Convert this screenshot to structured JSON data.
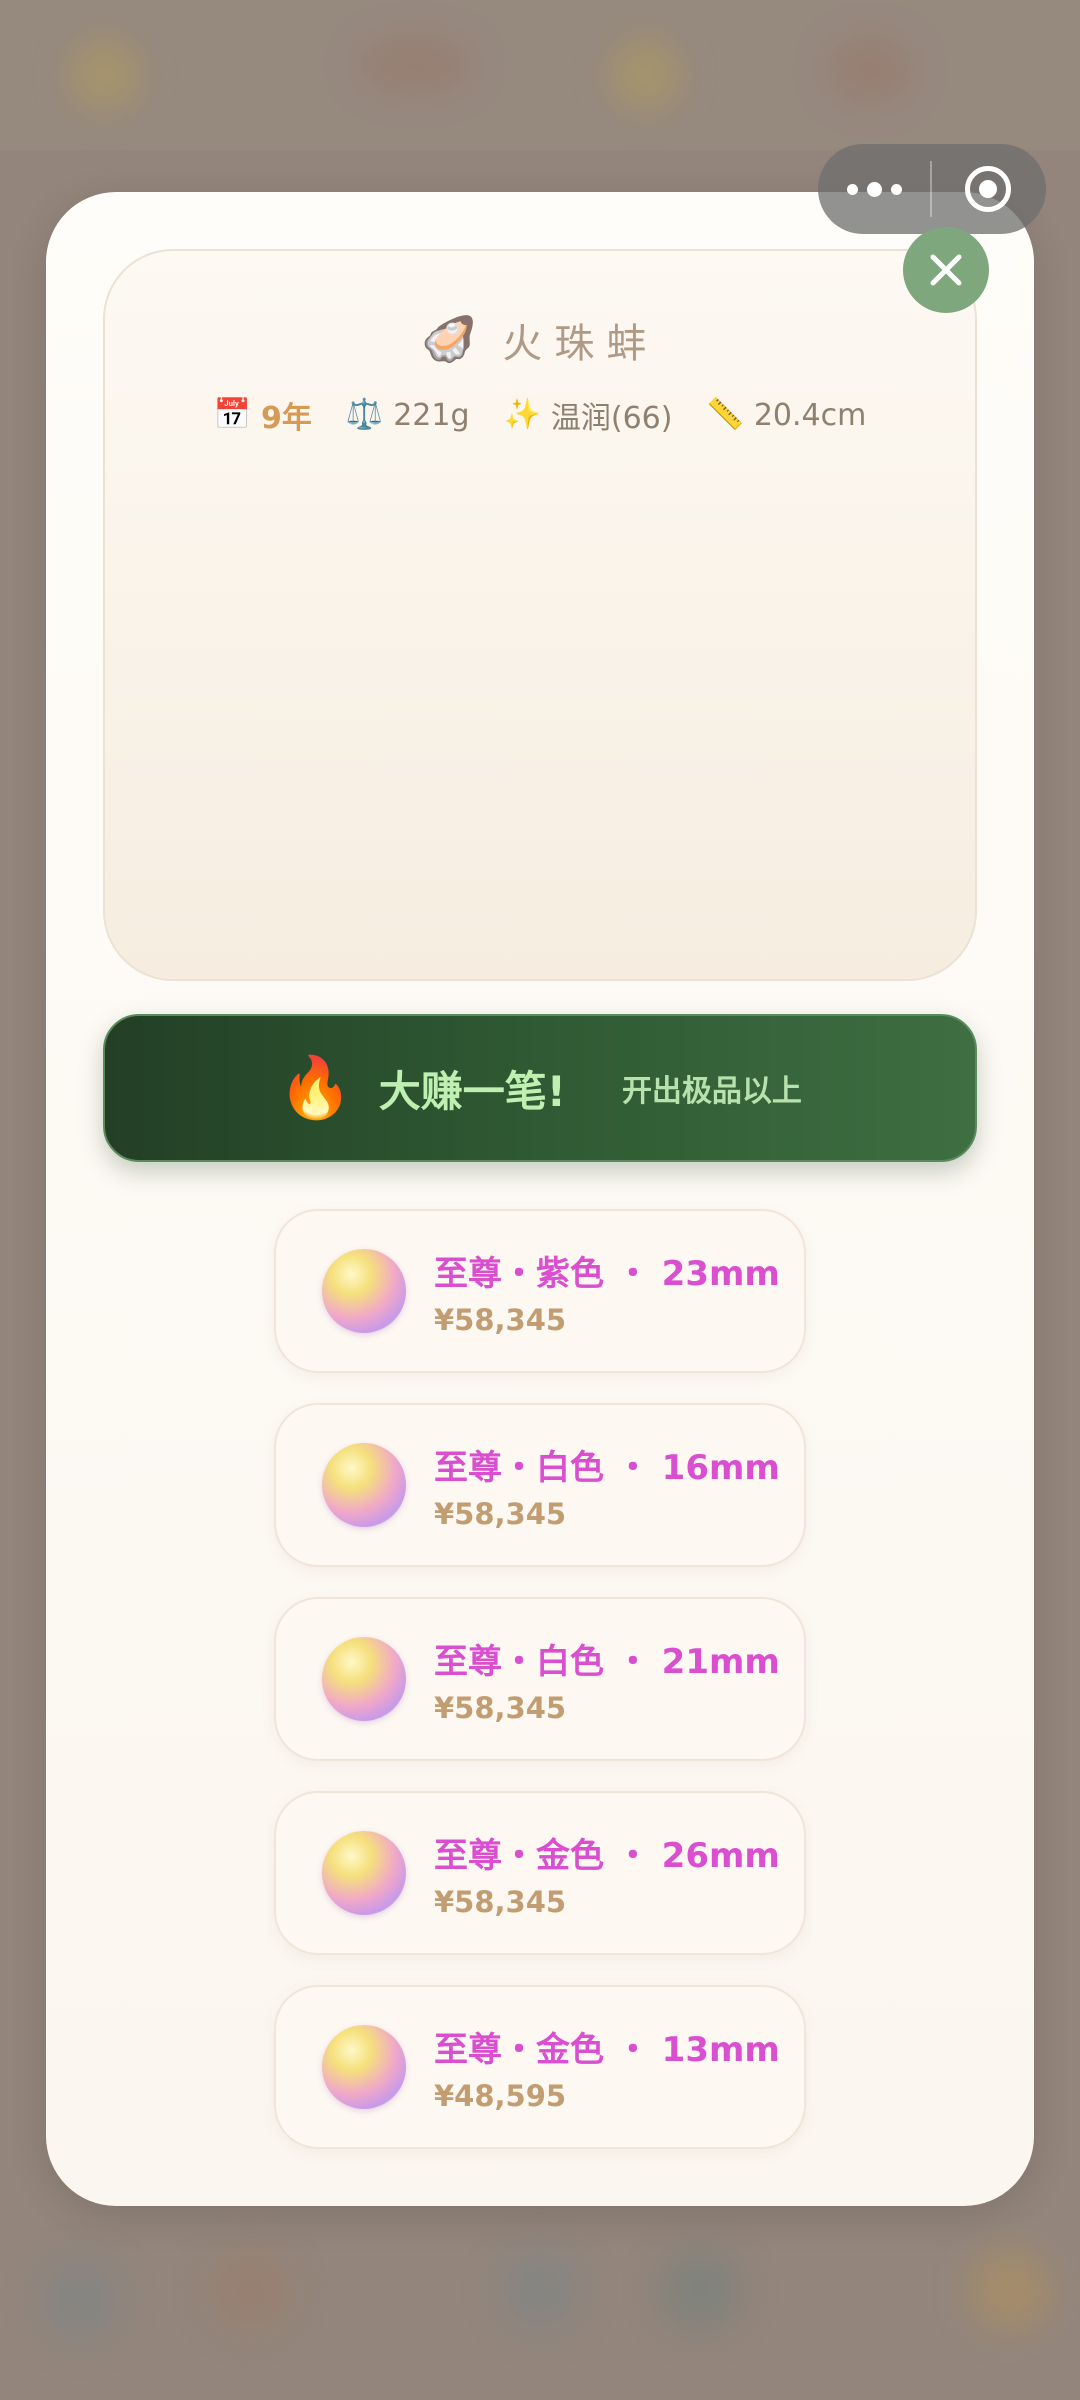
{
  "capsule": {
    "more_icon": "more-dots-icon",
    "target_icon": "record-target-icon"
  },
  "modal": {
    "close_icon": "close-icon",
    "clam": {
      "icon": "🦪",
      "name": "火珠蚌",
      "stats": [
        {
          "icon": "📅",
          "value": "9年",
          "name": "age"
        },
        {
          "icon": "⚖️",
          "value": "221g",
          "name": "weight"
        },
        {
          "icon": "✨",
          "value": "温润(66)",
          "name": "luster"
        },
        {
          "icon": "📏",
          "value": "20.4cm",
          "name": "length"
        }
      ]
    },
    "banner": {
      "icon": "🔥",
      "headline": "大赚一笔!",
      "subtitle": "开出极品以上"
    },
    "pearls": [
      {
        "title": "至尊・紫色 ・ 23mm",
        "price": "¥58,345"
      },
      {
        "title": "至尊・白色 ・ 16mm",
        "price": "¥58,345"
      },
      {
        "title": "至尊・白色 ・ 21mm",
        "price": "¥58,345"
      },
      {
        "title": "至尊・金色 ・ 26mm",
        "price": "¥58,345"
      },
      {
        "title": "至尊・金色 ・ 13mm",
        "price": "¥48,595"
      }
    ]
  },
  "colors": {
    "accent_green": "#7fa77e",
    "banner_green": "#2f5a33",
    "pearl_title": "#d94fd0",
    "price": "#c29d72"
  }
}
